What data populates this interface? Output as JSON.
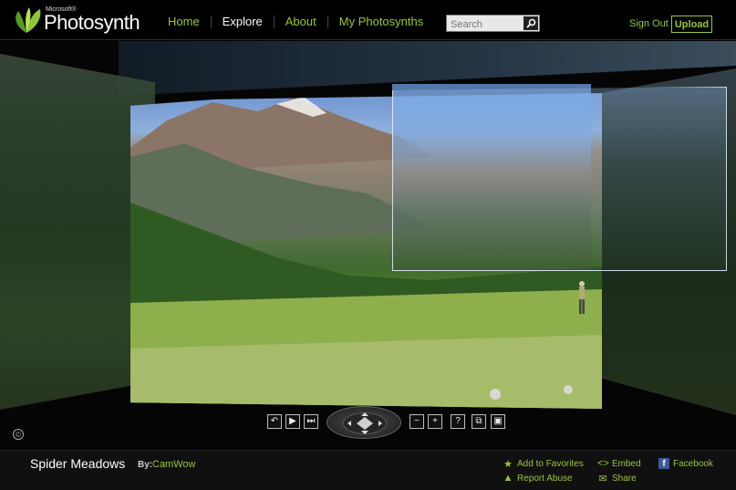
{
  "header": {
    "logo_small": "Microsoft®",
    "logo_name": "Photosynth",
    "nav": [
      {
        "label": "Home",
        "active": false
      },
      {
        "label": "Explore",
        "active": true
      },
      {
        "label": "About",
        "active": false
      },
      {
        "label": "My Photosynths",
        "active": false
      }
    ],
    "search_placeholder": "Search",
    "sign_out": "Sign Out",
    "upload": "Upload"
  },
  "viewer": {
    "controls": [
      "rotate-left",
      "play",
      "next",
      "zoom-out",
      "zoom-in",
      "help",
      "overlay",
      "fullscreen"
    ],
    "copyright_symbol": "©"
  },
  "footer": {
    "title": "Spider Meadows",
    "by_label": "By:",
    "author": "CamWow",
    "actions": {
      "favorites": "Add to Favorites",
      "report": "Report Abuse",
      "embed": "Embed",
      "share": "Share",
      "facebook": "Facebook"
    }
  },
  "colors": {
    "accent": "#9ac63a",
    "background": "#000000",
    "facebook": "#3b5998"
  }
}
